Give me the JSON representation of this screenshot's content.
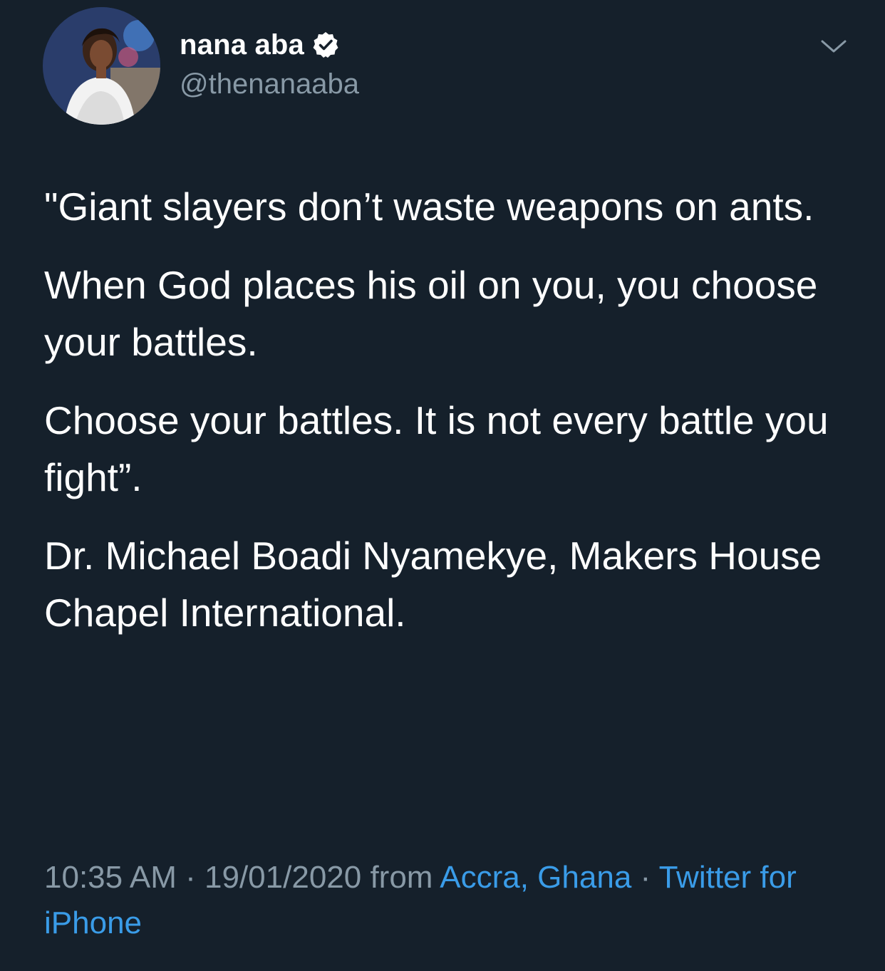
{
  "user": {
    "display_name": "nana aba",
    "handle": "@thenanaaba",
    "verified": true
  },
  "tweet": {
    "paragraphs": [
      "\"Giant slayers don’t waste weapons on ants.",
      "When God places his oil on you, you choose your battles.",
      "Choose your battles. It is not every battle you fight”.",
      "Dr. Michael Boadi Nyamekye, Makers House Chapel International."
    ]
  },
  "meta": {
    "time": "10:35 AM",
    "separator": " · ",
    "date": "19/01/2020",
    "from_label": " from ",
    "location": "Accra, Ghana",
    "source": "Twitter for iPhone"
  },
  "icons": {
    "verified": "verified-badge-icon",
    "menu": "chevron-down-icon"
  },
  "colors": {
    "background": "#15202b",
    "text": "#ffffff",
    "muted": "#8899a6",
    "link": "#3a9ce8"
  }
}
